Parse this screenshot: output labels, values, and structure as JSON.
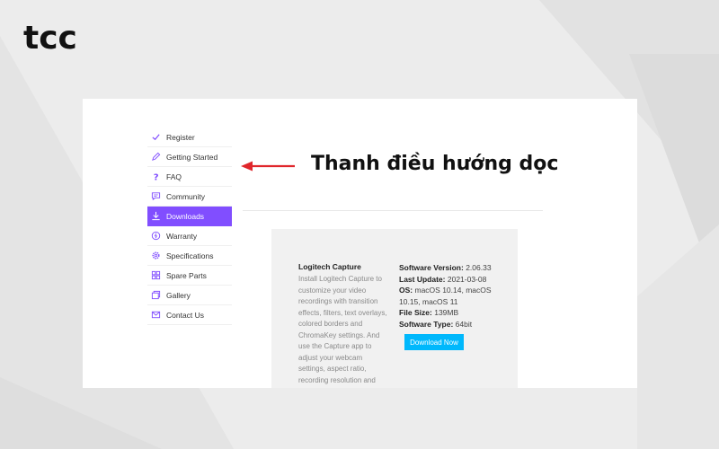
{
  "brand": {
    "logo_text": "tcc"
  },
  "sidebar": {
    "items": [
      {
        "label": "Register",
        "icon": "check-icon",
        "active": false
      },
      {
        "label": "Getting Started",
        "icon": "pencil-icon",
        "active": false
      },
      {
        "label": "FAQ",
        "icon": "question-icon",
        "active": false
      },
      {
        "label": "Community",
        "icon": "chat-icon",
        "active": false
      },
      {
        "label": "Downloads",
        "icon": "download-icon",
        "active": true
      },
      {
        "label": "Warranty",
        "icon": "warranty-icon",
        "active": false
      },
      {
        "label": "Specifications",
        "icon": "gear-icon",
        "active": false
      },
      {
        "label": "Spare Parts",
        "icon": "grid-icon",
        "active": false
      },
      {
        "label": "Gallery",
        "icon": "gallery-icon",
        "active": false
      },
      {
        "label": "Contact Us",
        "icon": "mail-icon",
        "active": false
      }
    ]
  },
  "annotation": {
    "text": "Thanh điều hướng dọc",
    "arrow_color": "#e0262b"
  },
  "product": {
    "title": "Logitech Capture",
    "description": "Install Logitech Capture to customize your video recordings with transition effects, filters, text overlays, colored borders and ChromaKey settings. And use the Capture app to adjust your webcam settings, aspect ratio, recording resolution and",
    "specs": [
      {
        "label": "Software Version:",
        "value": "2.06.33"
      },
      {
        "label": "Last Update:",
        "value": "2021-03-08"
      },
      {
        "label": "OS:",
        "value": "macOS 10.14, macOS 10.15, macOS 11"
      },
      {
        "label": "File Size:",
        "value": "139MB"
      },
      {
        "label": "Software Type:",
        "value": "64bit"
      }
    ],
    "download_label": "Download Now"
  },
  "colors": {
    "accent": "#814eff",
    "button": "#00b8fc",
    "arrow": "#e0262b"
  }
}
